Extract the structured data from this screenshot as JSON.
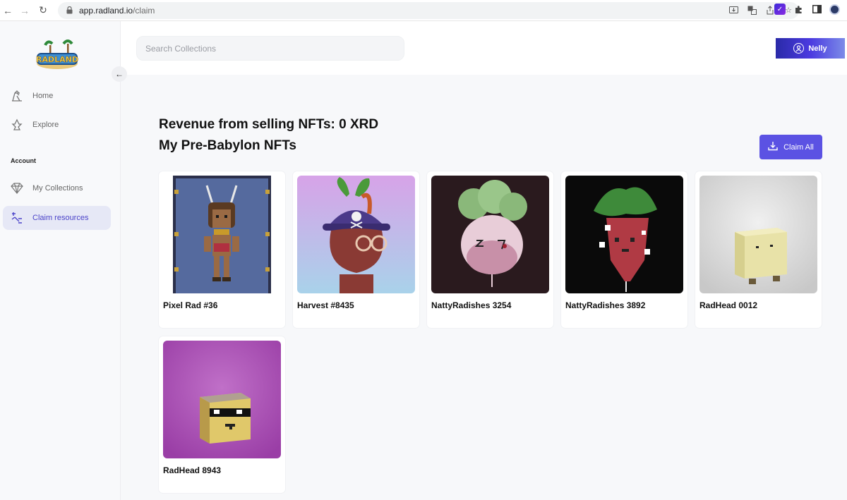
{
  "browser": {
    "url_host": "app.radland.io",
    "url_path": "/claim"
  },
  "sidebar": {
    "nav_items": [
      {
        "label": "Home",
        "icon": "home-icon"
      },
      {
        "label": "Explore",
        "icon": "explore-icon"
      }
    ],
    "section_label": "Account",
    "account_items": [
      {
        "label": "My Collections",
        "icon": "collections-icon"
      },
      {
        "label": "Claim resources",
        "icon": "claim-icon",
        "active": true
      }
    ]
  },
  "header": {
    "search_placeholder": "Search Collections",
    "user_name": "Nelly"
  },
  "main": {
    "revenue_title": "Revenue from selling NFTs: 0 XRD",
    "section_title": "My Pre-Babylon NFTs",
    "claim_all_label": "Claim All",
    "nfts": [
      {
        "name": "Pixel Rad #36"
      },
      {
        "name": "Harvest #8435"
      },
      {
        "name": "NattyRadishes 3254"
      },
      {
        "name": "NattyRadishes 3892"
      },
      {
        "name": "RadHead 0012"
      },
      {
        "name": "RadHead 8943"
      }
    ]
  },
  "colors": {
    "accent": "#5b52e3",
    "active_nav_bg": "#e6e8f6"
  }
}
